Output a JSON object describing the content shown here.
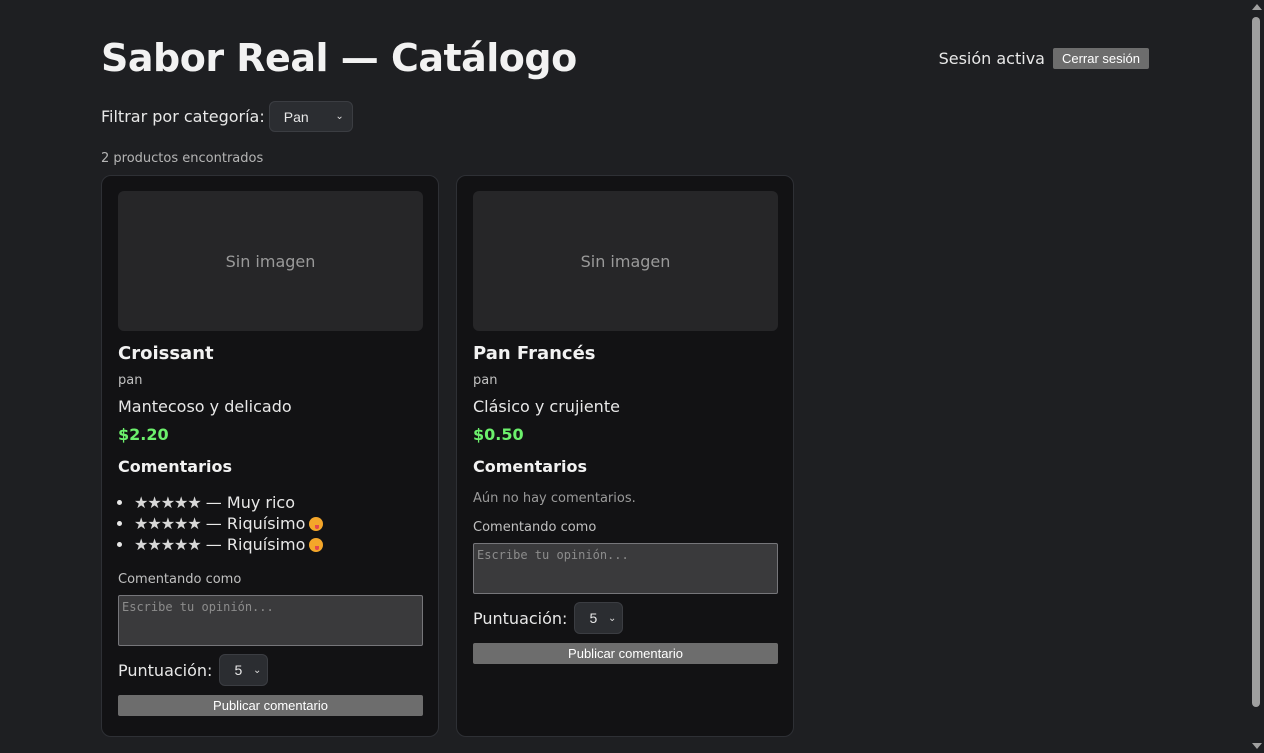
{
  "header": {
    "title": "Sabor Real — Catálogo",
    "session_text": "Sesión activa",
    "logout_label": "Cerrar sesión"
  },
  "filter": {
    "label": "Filtrar por categoría:",
    "selected": "Pan"
  },
  "results_count": "2 productos encontrados",
  "products": [
    {
      "image_placeholder": "Sin imagen",
      "name": "Croissant",
      "category": "pan",
      "description": "Mantecoso y delicado",
      "price": "$2.20",
      "comments_heading": "Comentarios",
      "comments": [
        {
          "stars": "★★★★★",
          "text": " — Muy rico",
          "emoji": false
        },
        {
          "stars": "★★★★★",
          "text": " — Riquísimo",
          "emoji": true
        },
        {
          "stars": "★★★★★",
          "text": " — Riquísimo",
          "emoji": true
        }
      ],
      "commenting_as": "Comentando como",
      "textarea_placeholder": "Escribe tu opinión...",
      "rating_label": "Puntuación:",
      "rating_value": "5",
      "publish_label": "Publicar comentario"
    },
    {
      "image_placeholder": "Sin imagen",
      "name": "Pan Francés",
      "category": "pan",
      "description": "Clásico y crujiente",
      "price": "$0.50",
      "comments_heading": "Comentarios",
      "no_comments": "Aún no hay comentarios.",
      "commenting_as": "Comentando como",
      "textarea_placeholder": "Escribe tu opinión...",
      "rating_label": "Puntuación:",
      "rating_value": "5",
      "publish_label": "Publicar comentario"
    }
  ],
  "colors": {
    "background": "#1e1f22",
    "card": "#121214",
    "price": "#6cf06c",
    "button": "#6d6d6d"
  }
}
